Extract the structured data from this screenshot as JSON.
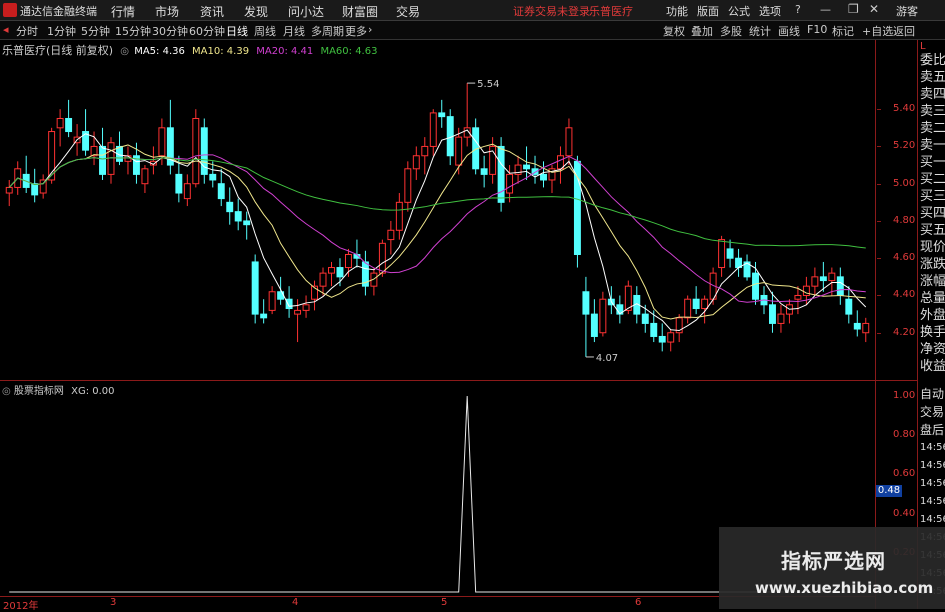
{
  "titlebar": {
    "app_title": "通达信金融终端",
    "menus": [
      "行情",
      "市场",
      "资讯",
      "发现",
      "问小达",
      "财富圈",
      "交易"
    ],
    "warning": "证券交易未登录",
    "stock_name": "乐普医疗",
    "tools": [
      "功能",
      "版面",
      "公式",
      "选项"
    ],
    "guest": "游客"
  },
  "periods": [
    "分时",
    "1分钟",
    "5分钟",
    "15分钟",
    "30分钟",
    "60分钟",
    "日线",
    "周线",
    "月线",
    "多周期",
    "更多"
  ],
  "active_period": "日线",
  "right_buttons": [
    "复权",
    "叠加",
    "多股",
    "统计",
    "画线",
    "F10",
    "标记",
    "+自选",
    "返回"
  ],
  "main_chart": {
    "stock_label": "乐普医疗(日线 前复权)",
    "ma5": "MA5: 4.36",
    "ma10": "MA10: 4.39",
    "ma20": "MA20: 4.41",
    "ma60": "MA60: 4.63",
    "price_ticks": [
      "5.40",
      "5.20",
      "5.00",
      "4.80",
      "4.60",
      "4.40",
      "4.20"
    ],
    "high_label": "5.54",
    "low_label": "4.07"
  },
  "indicator": {
    "label": "股票指标网",
    "xg": "XG: 0.00",
    "ticks": [
      "1.00",
      "0.80",
      "0.60",
      "0.40",
      "0.20"
    ],
    "current": "0.48"
  },
  "x_axis": {
    "labels": [
      "2012年",
      "3",
      "4",
      "5",
      "6"
    ]
  },
  "right_panel": {
    "top_letter": "L",
    "items": [
      "委比",
      "卖五",
      "卖四",
      "卖三",
      "卖二",
      "卖一",
      "买一",
      "买二",
      "买三",
      "买四",
      "买五",
      "现价",
      "涨跌",
      "涨幅",
      "总量",
      "外盘",
      "换手",
      "净资",
      "收益"
    ]
  },
  "right_panel2": {
    "items": [
      "自动",
      "交易",
      "盘后",
      "14:56",
      "14:56",
      "14:56",
      "14:56",
      "14:56",
      "14:56",
      "14:56",
      "14:56",
      "14:56"
    ]
  },
  "watermark": {
    "title": "指标严选网",
    "url": "www.xuezhibiao.com"
  },
  "chart_data": {
    "type": "candlestick",
    "ylim": [
      4.0,
      5.6
    ],
    "candles": [
      [
        4.95,
        5.02,
        4.88,
        4.98
      ],
      [
        4.98,
        5.12,
        4.94,
        5.08
      ],
      [
        5.05,
        5.15,
        4.95,
        4.98
      ],
      [
        5.0,
        5.08,
        4.9,
        4.94
      ],
      [
        4.95,
        5.05,
        4.92,
        5.02
      ],
      [
        5.02,
        5.3,
        5.0,
        5.28
      ],
      [
        5.3,
        5.4,
        5.2,
        5.35
      ],
      [
        5.35,
        5.45,
        5.25,
        5.28
      ],
      [
        5.22,
        5.32,
        5.15,
        5.25
      ],
      [
        5.28,
        5.4,
        5.15,
        5.18
      ],
      [
        5.15,
        5.28,
        5.1,
        5.2
      ],
      [
        5.2,
        5.3,
        5.02,
        5.05
      ],
      [
        5.05,
        5.25,
        5.0,
        5.22
      ],
      [
        5.2,
        5.28,
        5.1,
        5.12
      ],
      [
        5.12,
        5.2,
        5.05,
        5.15
      ],
      [
        5.15,
        5.22,
        5.0,
        5.05
      ],
      [
        5.0,
        5.1,
        4.95,
        5.08
      ],
      [
        5.1,
        5.2,
        5.05,
        5.12
      ],
      [
        5.15,
        5.35,
        5.1,
        5.3
      ],
      [
        5.3,
        5.45,
        5.05,
        5.1
      ],
      [
        5.05,
        5.15,
        4.9,
        4.95
      ],
      [
        4.92,
        5.05,
        4.88,
        5.0
      ],
      [
        5.0,
        5.4,
        4.98,
        5.35
      ],
      [
        5.3,
        5.35,
        5.0,
        5.05
      ],
      [
        5.05,
        5.12,
        4.98,
        5.02
      ],
      [
        5.0,
        5.08,
        4.88,
        4.92
      ],
      [
        4.9,
        4.98,
        4.78,
        4.85
      ],
      [
        4.85,
        4.92,
        4.75,
        4.8
      ],
      [
        4.8,
        4.85,
        4.7,
        4.78
      ],
      [
        4.58,
        4.62,
        4.25,
        4.3
      ],
      [
        4.3,
        4.38,
        4.25,
        4.28
      ],
      [
        4.32,
        4.45,
        4.3,
        4.42
      ],
      [
        4.42,
        4.5,
        4.35,
        4.38
      ],
      [
        4.38,
        4.45,
        4.28,
        4.33
      ],
      [
        4.3,
        4.38,
        4.15,
        4.32
      ],
      [
        4.32,
        4.4,
        4.28,
        4.35
      ],
      [
        4.38,
        4.48,
        4.32,
        4.45
      ],
      [
        4.45,
        4.55,
        4.4,
        4.52
      ],
      [
        4.52,
        4.58,
        4.45,
        4.55
      ],
      [
        4.55,
        4.6,
        4.45,
        4.5
      ],
      [
        4.55,
        4.65,
        4.5,
        4.62
      ],
      [
        4.62,
        4.7,
        4.55,
        4.6
      ],
      [
        4.58,
        4.64,
        4.4,
        4.45
      ],
      [
        4.45,
        4.55,
        4.4,
        4.52
      ],
      [
        4.52,
        4.7,
        4.5,
        4.68
      ],
      [
        4.7,
        4.8,
        4.62,
        4.75
      ],
      [
        4.75,
        4.95,
        4.7,
        4.9
      ],
      [
        4.9,
        5.12,
        4.85,
        5.08
      ],
      [
        5.08,
        5.2,
        5.02,
        5.15
      ],
      [
        5.15,
        5.25,
        5.05,
        5.2
      ],
      [
        5.2,
        5.4,
        5.15,
        5.38
      ],
      [
        5.38,
        5.45,
        5.3,
        5.36
      ],
      [
        5.36,
        5.4,
        5.1,
        5.15
      ],
      [
        5.1,
        5.3,
        5.05,
        5.25
      ],
      [
        5.25,
        5.54,
        5.2,
        5.3
      ],
      [
        5.3,
        5.35,
        5.05,
        5.08
      ],
      [
        5.08,
        5.15,
        4.98,
        5.05
      ],
      [
        5.05,
        5.25,
        5.0,
        5.2
      ],
      [
        5.2,
        5.25,
        4.85,
        4.9
      ],
      [
        4.95,
        5.1,
        4.9,
        5.05
      ],
      [
        5.05,
        5.15,
        5.0,
        5.1
      ],
      [
        5.1,
        5.2,
        5.02,
        5.08
      ],
      [
        5.08,
        5.15,
        5.0,
        5.05
      ],
      [
        5.05,
        5.12,
        4.98,
        5.02
      ],
      [
        5.02,
        5.1,
        4.95,
        5.08
      ],
      [
        5.08,
        5.2,
        5.0,
        5.15
      ],
      [
        5.15,
        5.35,
        5.1,
        5.3
      ],
      [
        5.12,
        5.15,
        4.55,
        4.62
      ],
      [
        4.42,
        4.5,
        4.07,
        4.3
      ],
      [
        4.3,
        4.38,
        4.15,
        4.18
      ],
      [
        4.2,
        4.42,
        4.18,
        4.38
      ],
      [
        4.38,
        4.45,
        4.3,
        4.35
      ],
      [
        4.35,
        4.4,
        4.25,
        4.3
      ],
      [
        4.32,
        4.48,
        4.3,
        4.45
      ],
      [
        4.4,
        4.45,
        4.25,
        4.3
      ],
      [
        4.3,
        4.35,
        4.2,
        4.25
      ],
      [
        4.25,
        4.32,
        4.15,
        4.18
      ],
      [
        4.18,
        4.25,
        4.1,
        4.15
      ],
      [
        4.15,
        4.22,
        4.1,
        4.2
      ],
      [
        4.2,
        4.3,
        4.15,
        4.28
      ],
      [
        4.28,
        4.4,
        4.25,
        4.38
      ],
      [
        4.38,
        4.45,
        4.3,
        4.33
      ],
      [
        4.33,
        4.4,
        4.25,
        4.38
      ],
      [
        4.38,
        4.55,
        4.35,
        4.52
      ],
      [
        4.55,
        4.72,
        4.5,
        4.7
      ],
      [
        4.65,
        4.7,
        4.55,
        4.6
      ],
      [
        4.6,
        4.65,
        4.5,
        4.55
      ],
      [
        4.58,
        4.62,
        4.48,
        4.5
      ],
      [
        4.52,
        4.58,
        4.35,
        4.38
      ],
      [
        4.4,
        4.45,
        4.3,
        4.35
      ],
      [
        4.35,
        4.42,
        4.2,
        4.25
      ],
      [
        4.25,
        4.35,
        4.2,
        4.3
      ],
      [
        4.3,
        4.38,
        4.25,
        4.35
      ],
      [
        4.38,
        4.45,
        4.3,
        4.4
      ],
      [
        4.4,
        4.5,
        4.35,
        4.45
      ],
      [
        4.45,
        4.55,
        4.4,
        4.5
      ],
      [
        4.5,
        4.58,
        4.42,
        4.48
      ],
      [
        4.48,
        4.55,
        4.4,
        4.52
      ],
      [
        4.5,
        4.55,
        4.35,
        4.4
      ],
      [
        4.38,
        4.45,
        4.25,
        4.3
      ],
      [
        4.25,
        4.32,
        4.18,
        4.22
      ],
      [
        4.2,
        4.28,
        4.15,
        4.25
      ]
    ],
    "indicator_xg": [
      0,
      0,
      0,
      0,
      0,
      0,
      0,
      0,
      0,
      0,
      0,
      0,
      0,
      0,
      0,
      0,
      0,
      0,
      0,
      0,
      0,
      0,
      0,
      0,
      0,
      0,
      0,
      0,
      0,
      0,
      0,
      0,
      0,
      0,
      0,
      0,
      0,
      0,
      0,
      0,
      0,
      0,
      0,
      0,
      0,
      0,
      0,
      0,
      0,
      0,
      0,
      0,
      0,
      0,
      1,
      0,
      0,
      0,
      0,
      0,
      0,
      0,
      0,
      0,
      0,
      0,
      0,
      0,
      0,
      0,
      0,
      0,
      0,
      0,
      0,
      0,
      0,
      0,
      0,
      0,
      0,
      0,
      0,
      0,
      0,
      0,
      0,
      0,
      0,
      0,
      0,
      0,
      0,
      0,
      0,
      0,
      0,
      0,
      0,
      0,
      0,
      0,
      0,
      0
    ],
    "ma_colors": {
      "ma5": "#ffffff",
      "ma10": "#f0e68c",
      "ma20": "#d040d0",
      "ma60": "#40c040"
    }
  }
}
